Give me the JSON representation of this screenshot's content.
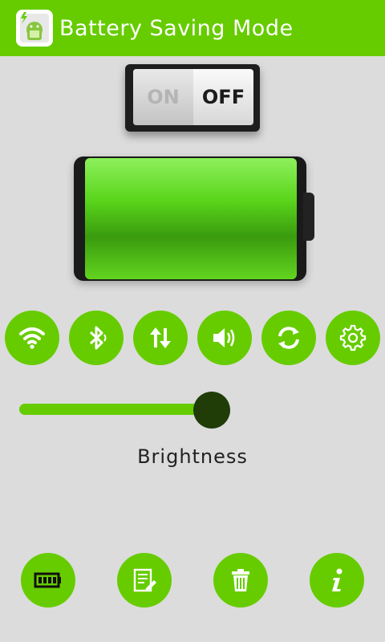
{
  "header": {
    "title": "Battery Saving Mode",
    "accent": "#66cc00"
  },
  "toggle": {
    "on_label": "ON",
    "off_label": "OFF",
    "state": "off"
  },
  "battery": {
    "level_percent": 100
  },
  "quick_settings": [
    {
      "name": "wifi-icon"
    },
    {
      "name": "bluetooth-icon"
    },
    {
      "name": "mobile-data-icon"
    },
    {
      "name": "volume-icon"
    },
    {
      "name": "sync-icon"
    },
    {
      "name": "settings-gear-icon"
    }
  ],
  "brightness": {
    "label": "Brightness",
    "value_percent": 100
  },
  "bottom_nav": [
    {
      "name": "battery-icon"
    },
    {
      "name": "notes-edit-icon"
    },
    {
      "name": "trash-icon"
    },
    {
      "name": "info-icon"
    }
  ]
}
